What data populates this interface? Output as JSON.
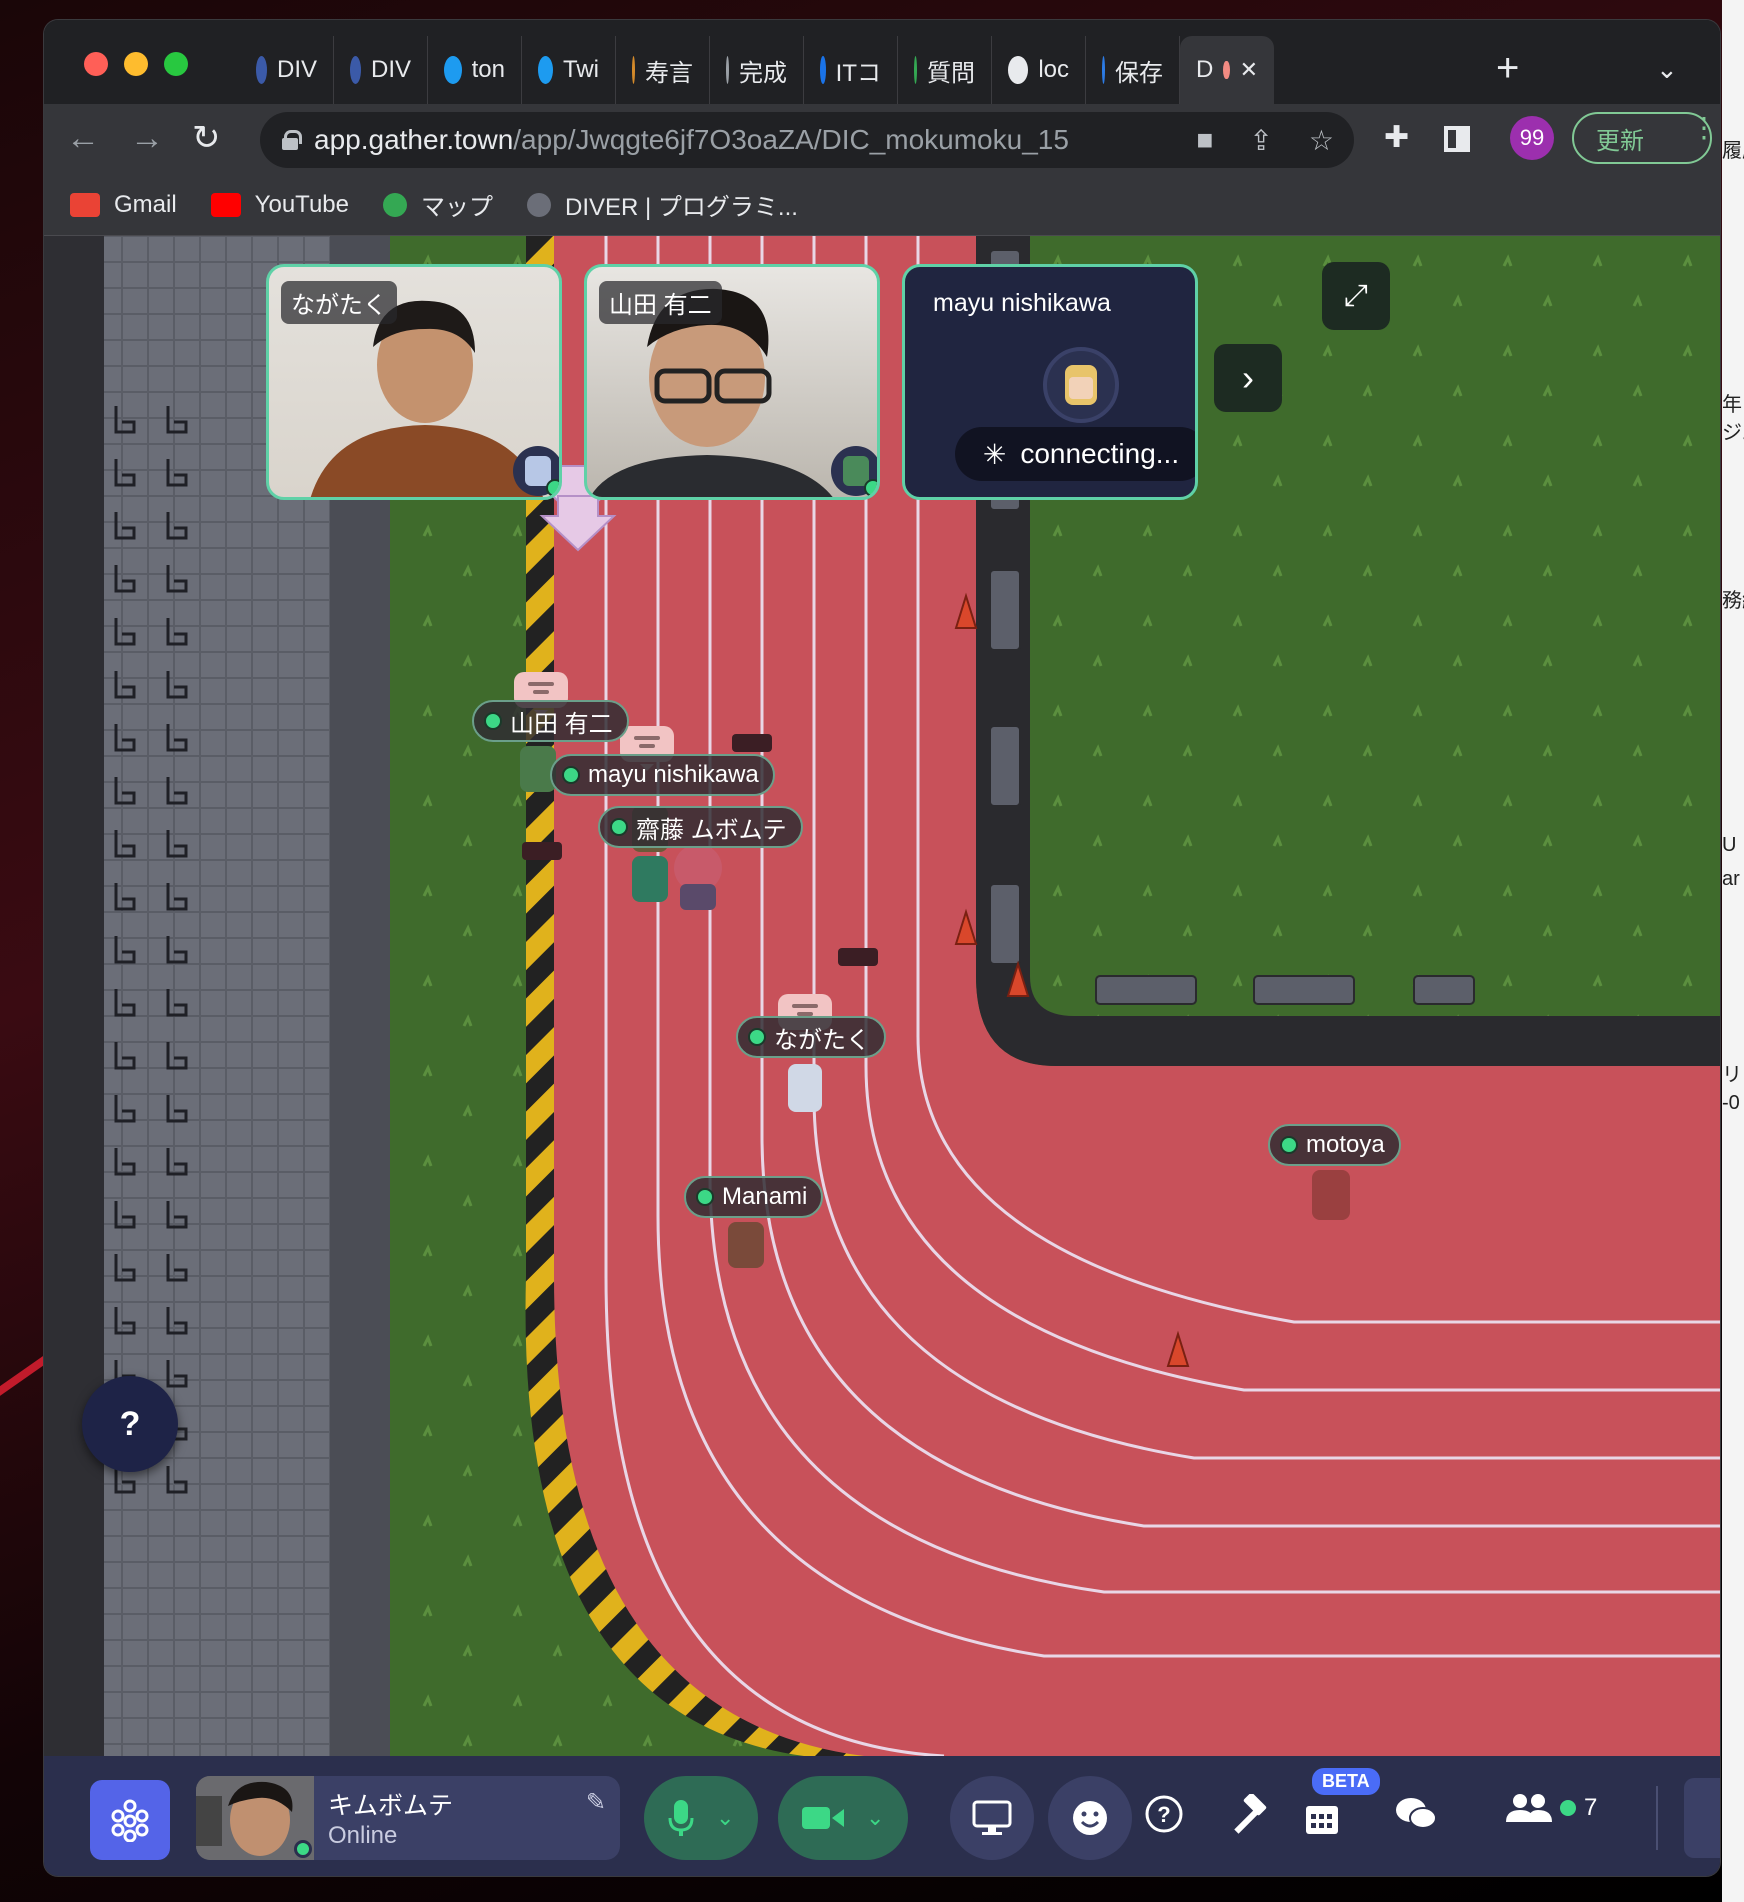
{
  "browser": {
    "tabs": [
      {
        "label": "DIV",
        "icon": "diver-icon",
        "color": "#3b5aa8"
      },
      {
        "label": "DIV",
        "icon": "diver-icon",
        "color": "#3b5aa8"
      },
      {
        "label": "ton",
        "icon": "twitter-icon",
        "color": "#1d9bf0"
      },
      {
        "label": "Twi",
        "icon": "twitter-icon",
        "color": "#1d9bf0"
      },
      {
        "label": "寿言",
        "icon": "sushi-icon",
        "color": "#d48a2a"
      },
      {
        "label": "完成",
        "icon": "globe-icon",
        "color": "#9aa0a6"
      },
      {
        "label": "ITコ",
        "icon": "c-logo-icon",
        "color": "#1a73e8"
      },
      {
        "label": "質問",
        "icon": "qa-icon",
        "color": "#34a853"
      },
      {
        "label": "loc",
        "icon": "globe-icon",
        "color": "#e8eaed"
      },
      {
        "label": "保存",
        "icon": "w-logo-icon",
        "color": "#2c7be5"
      },
      {
        "label": "D",
        "icon": "recording-icon",
        "color": "#f28b82",
        "active": true
      }
    ],
    "url_host": "app.gather.town",
    "url_path": "/app/Jwqgte6jf7O3oaZA/DIC_mokumoku_15",
    "profile_badge": "99",
    "update_label": "更新",
    "bookmarks": [
      {
        "label": "Gmail",
        "icon": "gmail-icon"
      },
      {
        "label": "YouTube",
        "icon": "youtube-icon"
      },
      {
        "label": "マップ",
        "icon": "maps-pin-icon"
      },
      {
        "label": "DIVER | プログラミ...",
        "icon": "globe-icon"
      }
    ]
  },
  "video_tiles": [
    {
      "name": "ながたく",
      "connecting": false
    },
    {
      "name": "山田 有二",
      "connecting": false
    },
    {
      "name": "mayu nishikawa",
      "connecting": true,
      "status": "connecting..."
    }
  ],
  "map_players": [
    {
      "name": "山田 有二",
      "speaking": true
    },
    {
      "name": "mayu nishikawa",
      "speaking": true
    },
    {
      "name": "齋藤 ムボムテ",
      "speaking": false
    },
    {
      "name": "ながたく",
      "speaking": true
    },
    {
      "name": "Manami",
      "speaking": false
    },
    {
      "name": "motoya",
      "speaking": false
    }
  ],
  "help_label": "?",
  "bottom_bar": {
    "user_name": "キムボムテ",
    "user_status": "Online",
    "beta_label": "BETA",
    "people_count": "7"
  },
  "desktop_edge_text": [
    "履歴",
    "年",
    "ジュ",
    "務紹",
    "U",
    "ar",
    "リー",
    "-0"
  ],
  "colors": {
    "track": "#c8515a",
    "grass": "#3f6b2c",
    "accent_green": "#5fd1a7",
    "bar": "#2b2f4d",
    "online": "#3cd886"
  }
}
